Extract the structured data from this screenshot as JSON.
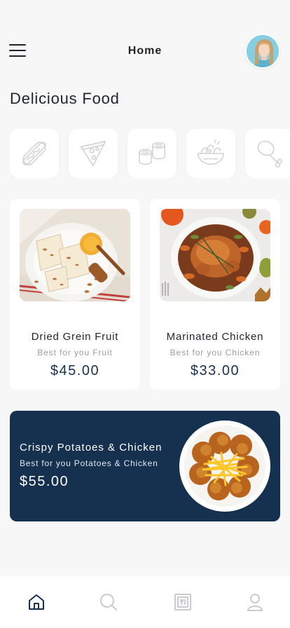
{
  "header": {
    "title": "Home",
    "menu_icon": "hamburger-menu-icon",
    "avatar_icon": "user-avatar"
  },
  "section": {
    "title": "Delicious Food"
  },
  "categories": [
    {
      "icon": "hotdog-icon"
    },
    {
      "icon": "pizza-slice-icon"
    },
    {
      "icon": "sushi-rolls-icon"
    },
    {
      "icon": "salad-bowl-icon"
    },
    {
      "icon": "chicken-leg-icon"
    }
  ],
  "cards": [
    {
      "name": "Dried Grein Fruit",
      "subtitle": "Best for you Fruit",
      "price": "$45.00",
      "image": "dried-fruit-bars-photo"
    },
    {
      "name": "Marinated Chicken",
      "subtitle": "Best for you Chicken",
      "price": "$33.00",
      "image": "roast-chicken-photo"
    }
  ],
  "featured": {
    "title": "Crispy Potatoes & Chicken",
    "subtitle": "Best for you Potatoes & Chicken",
    "price": "$55.00",
    "image": "fried-chicken-fries-photo"
  },
  "tabbar": {
    "items": [
      {
        "icon": "home-icon",
        "active": true
      },
      {
        "icon": "search-icon",
        "active": false
      },
      {
        "icon": "menu-book-icon",
        "active": false
      },
      {
        "icon": "profile-icon",
        "active": false
      }
    ]
  },
  "colors": {
    "accent": "#163150",
    "background": "#f7f7f8",
    "card": "#ffffff",
    "muted_text": "#9a9ca3",
    "inactive_icon": "#c9cbd0"
  }
}
